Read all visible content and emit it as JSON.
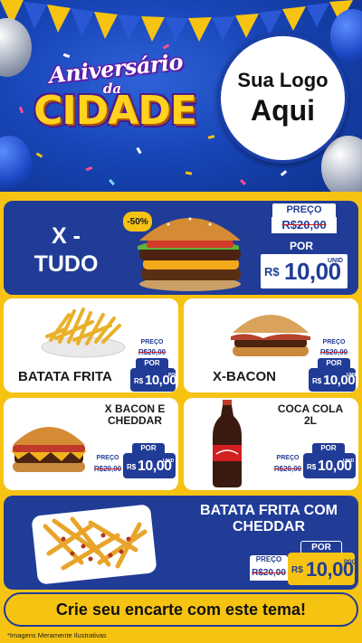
{
  "header": {
    "title_line1": "Aniversário",
    "title_line2": "da",
    "title_line3": "CIDADE",
    "logo_line1": "Sua Logo",
    "logo_line2": "Aqui"
  },
  "colors": {
    "brand_blue": "#213c97",
    "brand_yellow": "#f6c313",
    "strike_red": "#d61a1a"
  },
  "products": [
    {
      "name_line1": "X -",
      "name_line2": "TUDO",
      "discount_badge": "-50%",
      "price_label": "PREÇO",
      "old_price": "R$20,00",
      "por_label": "POR",
      "currency": "R$",
      "new_price": "10,00",
      "unit": "UNID",
      "icon": "burger-icon"
    },
    {
      "name": "BATATA FRITA",
      "price_label": "PREÇO",
      "old_price": "R$20,00",
      "por_label": "POR",
      "currency": "R$",
      "new_price": "10,00",
      "unit": "POÇ",
      "icon": "fries-icon"
    },
    {
      "name": "X-BACON",
      "price_label": "PREÇO",
      "old_price": "R$20,00",
      "por_label": "POR",
      "currency": "R$",
      "new_price": "10,00",
      "unit": "UNID",
      "icon": "burger-icon"
    },
    {
      "name_line1": "X BACON E",
      "name_line2": "CHEDDAR",
      "price_label": "PREÇO",
      "old_price": "R$20,00",
      "por_label": "POR",
      "currency": "R$",
      "new_price": "10,00",
      "unit": "UNID",
      "icon": "burger-icon"
    },
    {
      "name_line1": "COCA COLA",
      "name_line2": "2L",
      "price_label": "PREÇO",
      "old_price": "R$20,00",
      "por_label": "POR",
      "currency": "R$",
      "new_price": "10,00",
      "unit": "UNID",
      "icon": "soda-bottle-icon"
    },
    {
      "name_line1": "BATATA FRITA COM",
      "name_line2": "CHEDDAR",
      "price_label": "PREÇO",
      "old_price": "R$20,00",
      "por_label": "POR",
      "currency": "R$",
      "new_price": "10,00",
      "unit": "POÇ",
      "icon": "cheddar-fries-icon"
    }
  ],
  "footer": {
    "cta": "Crie seu encarte com este tema!",
    "disclaimer": "*Imagens Meramente Ilustrativas"
  }
}
